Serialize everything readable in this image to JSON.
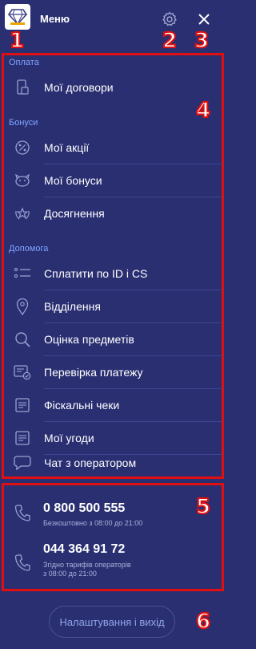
{
  "header": {
    "title": "Меню"
  },
  "markers": [
    "1",
    "2",
    "3",
    "4",
    "5",
    "6"
  ],
  "sections": {
    "payment": "Оплата",
    "bonuses": "Бонуси",
    "help": "Допомога"
  },
  "menu": {
    "contracts": "Мої договори",
    "promotions": "Мої акції",
    "my_bonuses": "Мої бонуси",
    "achievements": "Досягнення",
    "pay_by_id": "Сплатити по ID і CS",
    "branches": "Відділення",
    "appraisal": "Оцінка предметів",
    "payment_check": "Перевірка платежу",
    "fiscal_receipts": "Фіскальні чеки",
    "agreements": "Мої угоди",
    "operator_chat": "Чат з оператором"
  },
  "contacts": {
    "phone1": "0 800 500 555",
    "phone1_note": "Безкоштовно з 08:00 до 21:00",
    "phone2": "044 364 91 72",
    "phone2_note_line1": "Згідно тарифів операторів",
    "phone2_note_line2": "з 08:00 до 21:00"
  },
  "footer": {
    "settings_exit": "Налаштування і вихід"
  },
  "colors": {
    "background": "#2a2f72",
    "section_title": "#7fa4ff",
    "annotation": "#e01010",
    "button_text": "#8fa6e8"
  }
}
